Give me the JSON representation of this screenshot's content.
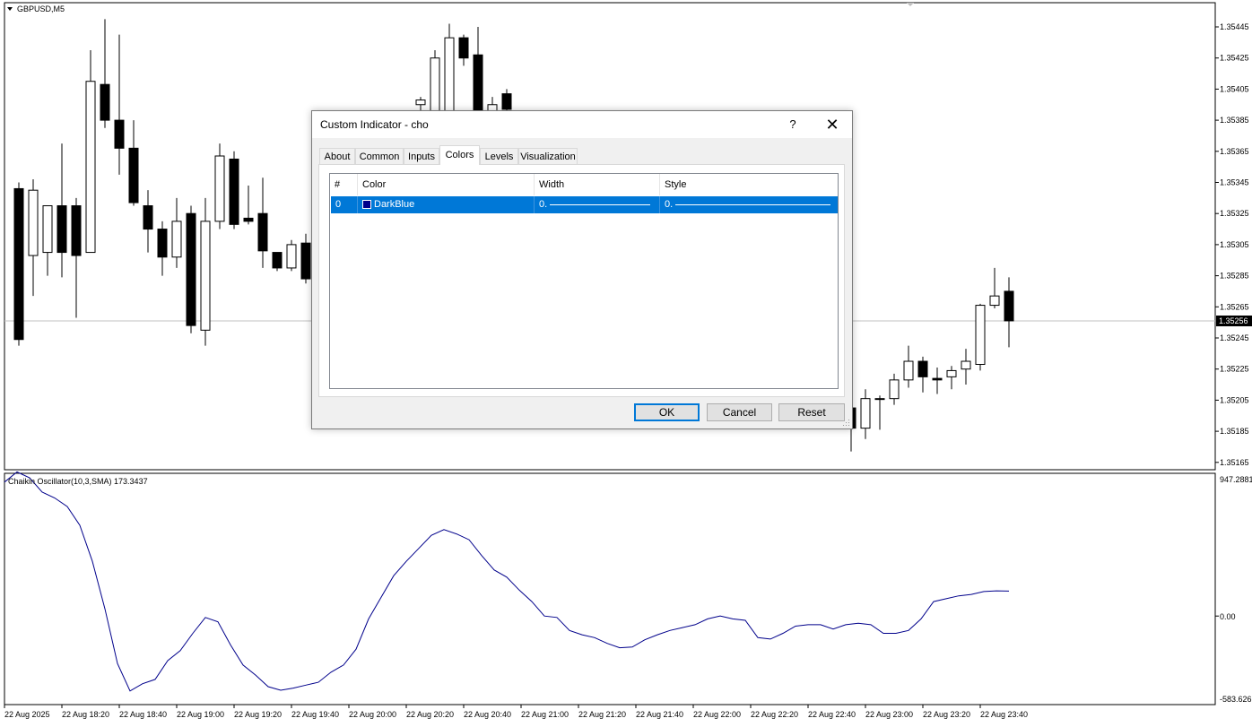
{
  "window": {
    "symbol_label": "GBPUSD,M5"
  },
  "price_axis": {
    "labels": [
      "1.35445",
      "1.35425",
      "1.35405",
      "1.35385",
      "1.35365",
      "1.35345",
      "1.35325",
      "1.35305",
      "1.35285",
      "1.35265",
      "1.35245",
      "1.35225",
      "1.35205",
      "1.35185",
      "1.35165"
    ],
    "current_price": "1.35256",
    "current_price_bg": "#000000"
  },
  "indicator": {
    "label": "Chaikin Oscillator(10,3,SMA) 173.3437",
    "axis_top": "947.2881",
    "axis_zero": "0.00",
    "axis_bottom": "-583.626",
    "line_color": "#00008B"
  },
  "time_axis": {
    "labels": [
      "22 Aug 2025",
      "22 Aug 18:20",
      "22 Aug 18:40",
      "22 Aug 19:00",
      "22 Aug 19:20",
      "22 Aug 19:40",
      "22 Aug 20:00",
      "22 Aug 20:20",
      "22 Aug 20:40",
      "22 Aug 21:00",
      "22 Aug 21:20",
      "22 Aug 21:40",
      "22 Aug 22:00",
      "22 Aug 22:20",
      "22 Aug 22:40",
      "22 Aug 23:00",
      "22 Aug 23:20",
      "22 Aug 23:40"
    ]
  },
  "dialog": {
    "title": "Custom Indicator - cho",
    "help_label": "?",
    "close_label": "✕",
    "tabs": [
      "About",
      "Common",
      "Inputs",
      "Colors",
      "Levels",
      "Visualization"
    ],
    "active_tab": "Colors",
    "table": {
      "headers": [
        "#",
        "Color",
        "Width",
        "Style"
      ],
      "rows": [
        {
          "index": "0",
          "color_name": "DarkBlue",
          "color_hex": "#00008B",
          "width": "0.",
          "style": "0."
        }
      ]
    },
    "buttons": {
      "ok": "OK",
      "cancel": "Cancel",
      "reset": "Reset"
    }
  },
  "chart_data": {
    "type": "candlestick",
    "symbol": "GBPUSD",
    "timeframe": "M5",
    "ylim": [
      1.3516,
      1.3546
    ],
    "candles": [
      {
        "o": 1.35341,
        "h": 1.35345,
        "l": 1.3524,
        "c": 1.35244
      },
      {
        "o": 1.35298,
        "h": 1.35347,
        "l": 1.35272,
        "c": 1.3534
      },
      {
        "o": 1.353,
        "h": 1.35325,
        "l": 1.35285,
        "c": 1.3533
      },
      {
        "o": 1.3533,
        "h": 1.3537,
        "l": 1.35284,
        "c": 1.353
      },
      {
        "o": 1.3533,
        "h": 1.35335,
        "l": 1.35258,
        "c": 1.35298
      },
      {
        "o": 1.353,
        "h": 1.3543,
        "l": 1.353,
        "c": 1.3541
      },
      {
        "o": 1.35408,
        "h": 1.3545,
        "l": 1.3538,
        "c": 1.35385
      },
      {
        "o": 1.35385,
        "h": 1.3544,
        "l": 1.3535,
        "c": 1.35367
      },
      {
        "o": 1.35367,
        "h": 1.35385,
        "l": 1.3533,
        "c": 1.35332
      },
      {
        "o": 1.3533,
        "h": 1.3534,
        "l": 1.353,
        "c": 1.35315
      },
      {
        "o": 1.35315,
        "h": 1.3532,
        "l": 1.35285,
        "c": 1.35297
      },
      {
        "o": 1.35297,
        "h": 1.35335,
        "l": 1.3529,
        "c": 1.3532
      },
      {
        "o": 1.35325,
        "h": 1.3533,
        "l": 1.35248,
        "c": 1.35253
      },
      {
        "o": 1.3525,
        "h": 1.35335,
        "l": 1.3524,
        "c": 1.3532
      },
      {
        "o": 1.3532,
        "h": 1.3537,
        "l": 1.35315,
        "c": 1.35362
      },
      {
        "o": 1.3536,
        "h": 1.35365,
        "l": 1.35315,
        "c": 1.35318
      },
      {
        "o": 1.35322,
        "h": 1.35343,
        "l": 1.35318,
        "c": 1.3532
      },
      {
        "o": 1.35325,
        "h": 1.35348,
        "l": 1.3529,
        "c": 1.35301
      },
      {
        "o": 1.353,
        "h": 1.353,
        "l": 1.35288,
        "c": 1.3529
      },
      {
        "o": 1.3529,
        "h": 1.35308,
        "l": 1.35288,
        "c": 1.35305
      },
      {
        "o": 1.35306,
        "h": 1.35312,
        "l": 1.3528,
        "c": 1.35283
      },
      {
        "o": 1.35285,
        "h": 1.3529,
        "l": 1.35228,
        "c": 1.35252
      },
      {
        "o": 1.35254,
        "h": 1.3531,
        "l": 1.35254,
        "c": 1.35286
      },
      {
        "o": 1.35395,
        "h": 1.354,
        "l": 1.35385,
        "c": 1.35398
      },
      {
        "o": 1.3539,
        "h": 1.3543,
        "l": 1.35385,
        "c": 1.35425
      },
      {
        "o": 1.3539,
        "h": 1.35447,
        "l": 1.35385,
        "c": 1.35438
      },
      {
        "o": 1.35438,
        "h": 1.3544,
        "l": 1.3542,
        "c": 1.35425
      },
      {
        "o": 1.35427,
        "h": 1.35445,
        "l": 1.35385,
        "c": 1.3539
      },
      {
        "o": 1.35388,
        "h": 1.354,
        "l": 1.3538,
        "c": 1.35395
      },
      {
        "o": 1.35402,
        "h": 1.35405,
        "l": 1.35385,
        "c": 1.35392
      },
      {
        "o": 1.352,
        "h": 1.35205,
        "l": 1.35172,
        "c": 1.35187
      },
      {
        "o": 1.35187,
        "h": 1.35212,
        "l": 1.3518,
        "c": 1.35206
      },
      {
        "o": 1.35206,
        "h": 1.35208,
        "l": 1.35186,
        "c": 1.35206
      },
      {
        "o": 1.35206,
        "h": 1.35222,
        "l": 1.35202,
        "c": 1.35218
      },
      {
        "o": 1.35218,
        "h": 1.3524,
        "l": 1.35213,
        "c": 1.3523
      },
      {
        "o": 1.3523,
        "h": 1.35233,
        "l": 1.3521,
        "c": 1.3522
      },
      {
        "o": 1.35219,
        "h": 1.35226,
        "l": 1.35209,
        "c": 1.35218
      },
      {
        "o": 1.3522,
        "h": 1.35227,
        "l": 1.35212,
        "c": 1.35224
      },
      {
        "o": 1.35225,
        "h": 1.35238,
        "l": 1.35215,
        "c": 1.3523
      },
      {
        "o": 1.35228,
        "h": 1.35267,
        "l": 1.35224,
        "c": 1.35266
      },
      {
        "o": 1.35266,
        "h": 1.3529,
        "l": 1.35264,
        "c": 1.35272
      },
      {
        "o": 1.35275,
        "h": 1.35284,
        "l": 1.35239,
        "c": 1.35256
      }
    ],
    "oscillator": {
      "name": "Chaikin Oscillator(10,3,SMA)",
      "ylim": [
        -583.626,
        947.2881
      ],
      "values": [
        930,
        1000,
        960,
        860,
        820,
        760,
        630,
        380,
        50,
        -330,
        -520,
        -470,
        -440,
        -310,
        -240,
        -120,
        -10,
        -40,
        -200,
        -340,
        -410,
        -490,
        -515,
        -500,
        -480,
        -460,
        -390,
        -340,
        -230,
        -20,
        130,
        280,
        380,
        470,
        560,
        600,
        570,
        530,
        420,
        320,
        270,
        180,
        100,
        0,
        -10,
        -100,
        -130,
        -150,
        -190,
        -220,
        -215,
        -165,
        -130,
        -100,
        -80,
        -60,
        -20,
        0,
        -20,
        -30,
        -150,
        -160,
        -120,
        -70,
        -60,
        -60,
        -90,
        -60,
        -50,
        -60,
        -120,
        -120,
        -100,
        -20,
        100,
        120,
        140,
        150,
        170,
        175,
        173
      ]
    }
  }
}
